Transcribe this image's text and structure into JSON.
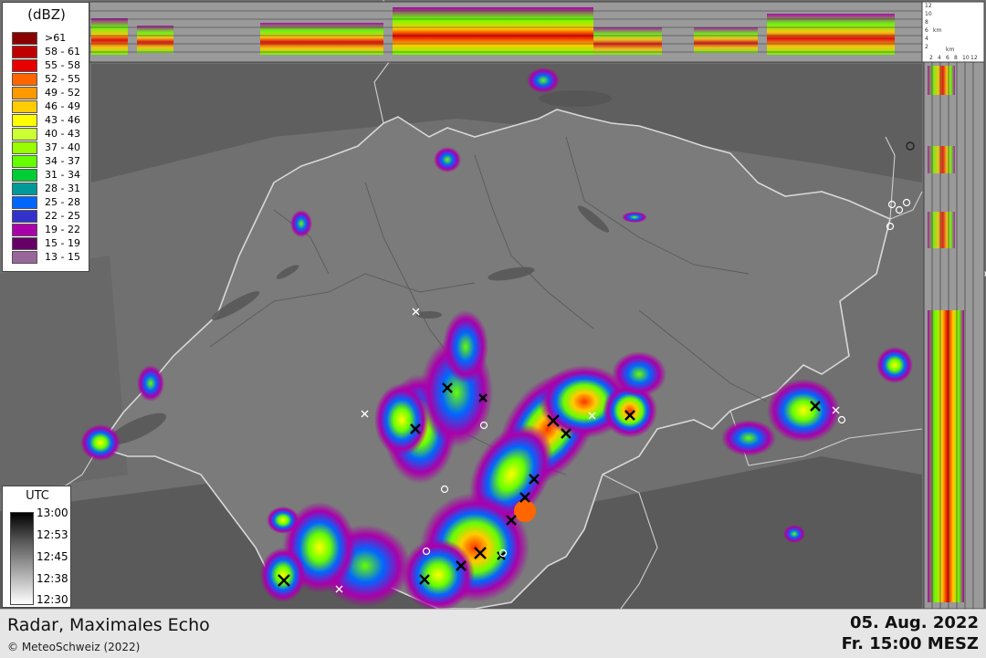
{
  "legend": {
    "title": "(dBZ)",
    "items": [
      {
        "label": ">61",
        "color": "#8b0000"
      },
      {
        "label": "58 - 61",
        "color": "#c00000"
      },
      {
        "label": "55 - 58",
        "color": "#e60000"
      },
      {
        "label": "52 - 55",
        "color": "#ff6600"
      },
      {
        "label": "49 - 52",
        "color": "#ff9900"
      },
      {
        "label": "46 - 49",
        "color": "#ffcc00"
      },
      {
        "label": "43 - 46",
        "color": "#ffff00"
      },
      {
        "label": "40 - 43",
        "color": "#ccff33"
      },
      {
        "label": "37 - 40",
        "color": "#99ff00"
      },
      {
        "label": "34 - 37",
        "color": "#66ff00"
      },
      {
        "label": "31 - 34",
        "color": "#00cc33"
      },
      {
        "label": "28 - 31",
        "color": "#009999"
      },
      {
        "label": "25 - 28",
        "color": "#0066ff"
      },
      {
        "label": "22 - 25",
        "color": "#3333cc"
      },
      {
        "label": "19 - 22",
        "color": "#aa00aa"
      },
      {
        "label": "15 - 19",
        "color": "#660066"
      },
      {
        "label": "13 - 15",
        "color": "#996699"
      }
    ]
  },
  "time_legend": {
    "title": "UTC",
    "ticks": [
      "13:00",
      "12:53",
      "12:45",
      "12:38",
      "12:30"
    ]
  },
  "profile_axes": {
    "top_km_ticks": [
      "12",
      "10",
      "8",
      "6",
      "4",
      "2"
    ],
    "unit": "km",
    "right_km_ticks": [
      "2",
      "4",
      "6",
      "8",
      "10",
      "12"
    ]
  },
  "footer": {
    "title": "Radar, Maximales Echo",
    "copyright": "© MeteoSchweiz (2022)",
    "date": "05. Aug. 2022",
    "time": "Fr. 15:00 MESZ"
  }
}
